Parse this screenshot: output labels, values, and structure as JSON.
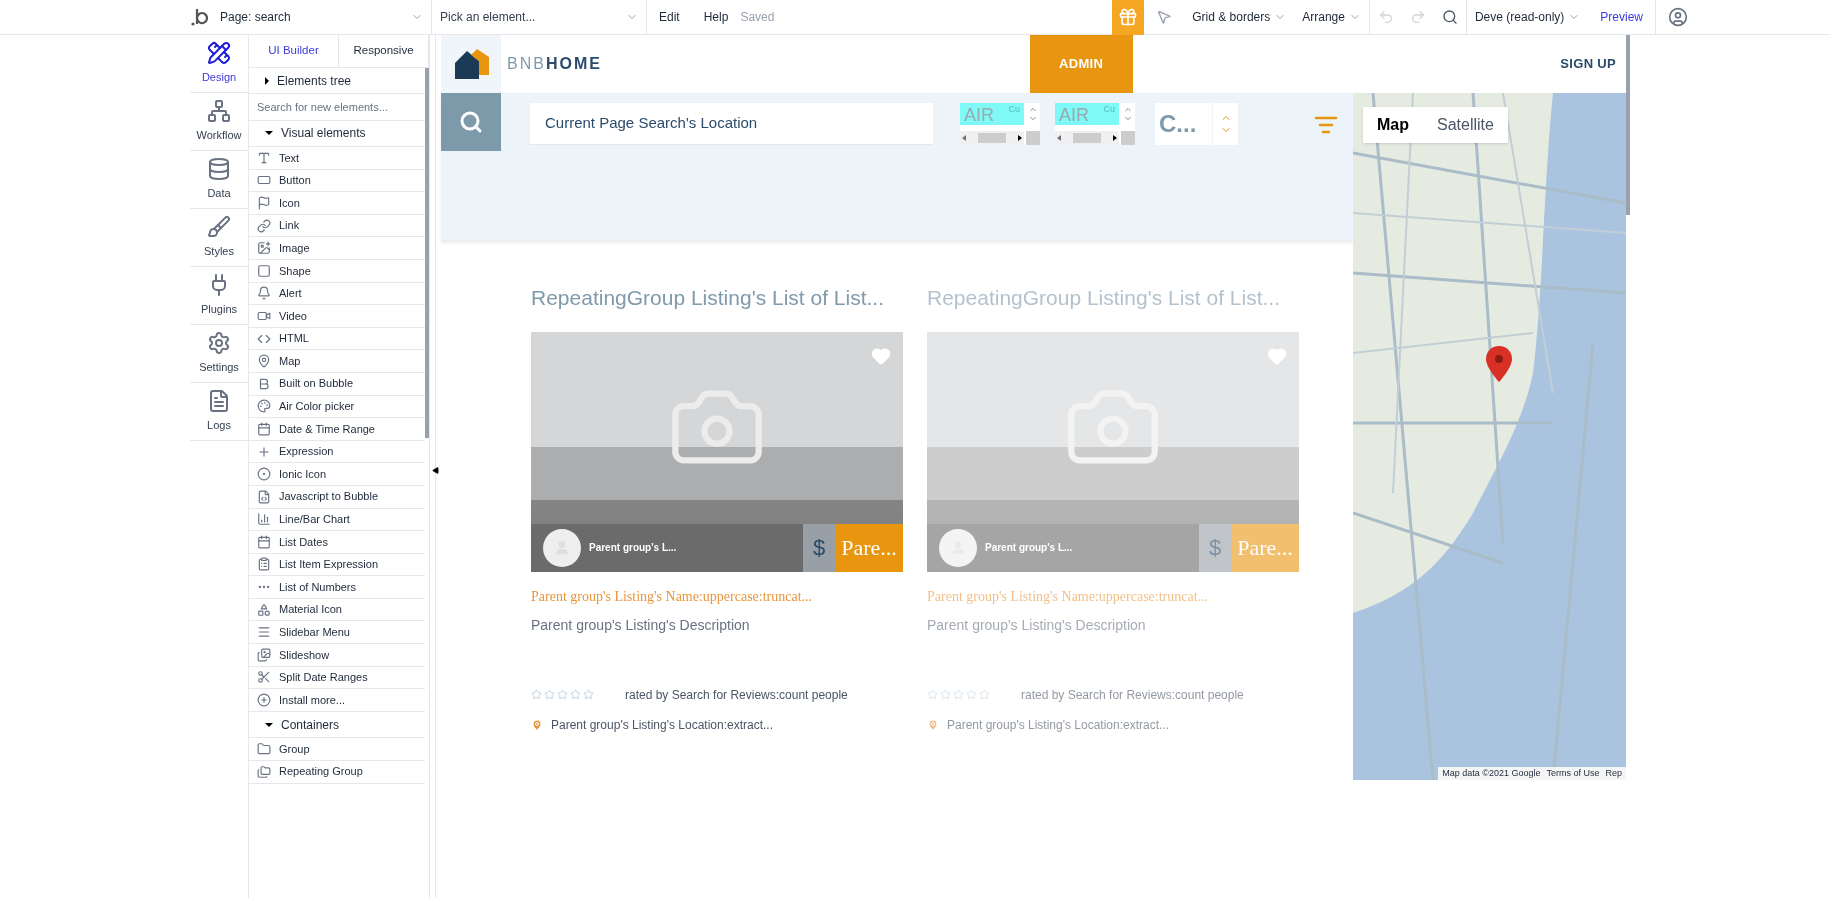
{
  "topbar": {
    "page_selector": "Page: search",
    "element_picker": "Pick an element...",
    "menu": [
      "Edit",
      "Help"
    ],
    "status": "Saved",
    "grid_menu": "Grid & borders",
    "arrange_menu": "Arrange",
    "user_menu": "Deve (read-only)",
    "preview": "Preview"
  },
  "sidebar": {
    "tabs": [
      {
        "label": "Design",
        "selected": true
      },
      {
        "label": "Workflow",
        "selected": false
      },
      {
        "label": "Data",
        "selected": false
      },
      {
        "label": "Styles",
        "selected": false
      },
      {
        "label": "Plugins",
        "selected": false
      },
      {
        "label": "Settings",
        "selected": false
      },
      {
        "label": "Logs",
        "selected": false
      }
    ]
  },
  "panel": {
    "tabs": [
      {
        "label": "UI Builder",
        "selected": true
      },
      {
        "label": "Responsive",
        "selected": false
      }
    ],
    "elements_tree": {
      "label": "Elements tree",
      "expanded": false
    },
    "search": {
      "placeholder": "Search for new elements..."
    },
    "sections": [
      {
        "label": "Visual elements",
        "expanded": true,
        "items": [
          "Text",
          "Button",
          "Icon",
          "Link",
          "Image",
          "Shape",
          "Alert",
          "Video",
          "HTML",
          "Map",
          "Built on Bubble",
          "Air Color picker",
          "Date & Time Range",
          "Expression",
          "Ionic Icon",
          "Javascript to Bubble",
          "Line/Bar Chart",
          "List Dates",
          "List Item Expression",
          "List of Numbers",
          "Material Icon",
          "Slidebar Menu",
          "Slideshow",
          "Split Date Ranges",
          "Install more..."
        ]
      },
      {
        "label": "Containers",
        "expanded": true,
        "items": [
          "Group",
          "Repeating Group"
        ]
      }
    ]
  },
  "canvas": {
    "header": {
      "brand_light": "BNB",
      "brand_bold": "HOME",
      "admin": "ADMIN",
      "sign_up": "SIGN UP"
    },
    "search_bar": {
      "location": "Current Page Search's Location",
      "inputs": [
        {
          "text": "AIR",
          "hint": "Cu"
        },
        {
          "text": "AIR",
          "hint": "Cu"
        }
      ],
      "sort": "C..."
    },
    "cards": [
      {
        "faded": false,
        "title": "RepeatingGroup Listing's List of List...",
        "host": "Parent group's L...",
        "currency": "$",
        "price": "Pare...",
        "name": "Parent group's Listing's Name:uppercase:truncat...",
        "description": "Parent group's Listing's Description",
        "stars": 0,
        "rating": "rated by Search for Reviews:count people",
        "location": "Parent group's Listing's Location:extract..."
      },
      {
        "faded": true,
        "title": "RepeatingGroup Listing's List of List...",
        "host": "Parent group's L...",
        "currency": "$",
        "price": "Pare...",
        "name": "Parent group's Listing's Name:uppercase:truncat...",
        "description": "Parent group's Listing's Description",
        "stars": 0,
        "rating": "rated by Search for Reviews:count people",
        "location": "Parent group's Listing's Location:extract..."
      }
    ],
    "map": {
      "tabs": [
        {
          "label": "Map",
          "selected": true
        },
        {
          "label": "Satellite",
          "selected": false
        }
      ],
      "footer": [
        "Map data ©2021 Google",
        "Terms of Use",
        "Rep"
      ]
    }
  }
}
